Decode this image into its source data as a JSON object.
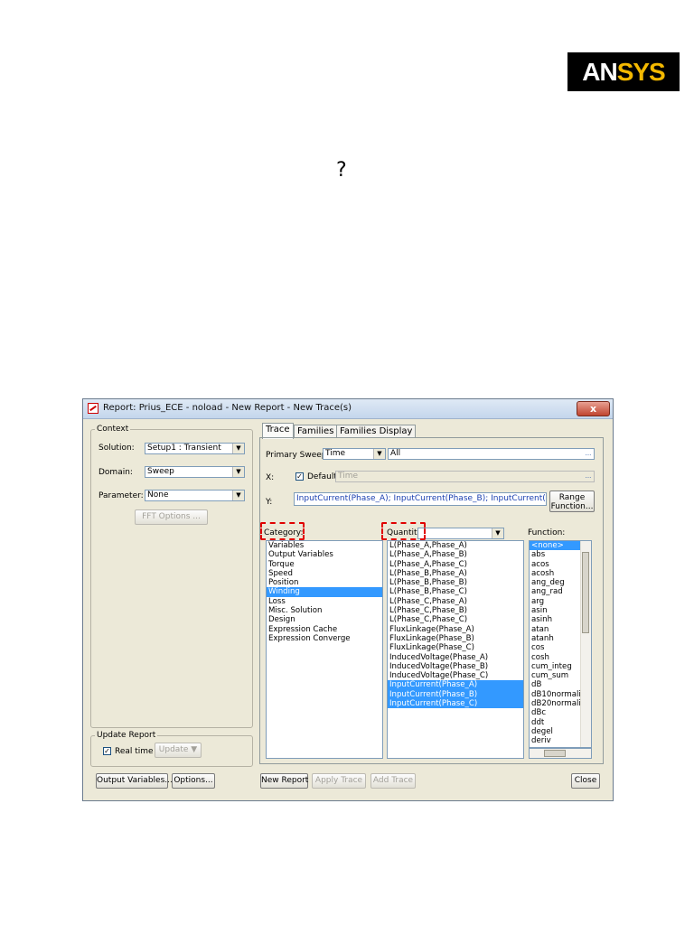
{
  "logo": {
    "part1": "AN",
    "part2": "SYS"
  },
  "question_mark": "?",
  "dialog": {
    "title": "Report: Prius_ECE - noload - New Report - New Trace(s)",
    "close_glyph": "x",
    "context": {
      "legend": "Context",
      "solution_label": "Solution:",
      "solution_value": "Setup1 : Transient",
      "domain_label": "Domain:",
      "domain_value": "Sweep",
      "parameter_label": "Parameter:",
      "parameter_value": "None",
      "fft_button": "FFT Options ..."
    },
    "update": {
      "legend": "Update Report",
      "realtime_label": "Real time",
      "realtime_checked": true,
      "update_button": "Update"
    },
    "tabs": [
      "Trace",
      "Families",
      "Families Display"
    ],
    "trace": {
      "primary_sweep_label": "Primary Sweep:",
      "primary_sweep_value": "Time",
      "primary_sweep_range": "All",
      "x_label": "X:",
      "default_label": "Default",
      "default_checked": true,
      "x_value": "Time",
      "y_label": "Y:",
      "y_value": "InputCurrent(Phase_A); InputCurrent(Phase_B); InputCurrent(Phase_C)",
      "range_function_button": [
        "Range",
        "Function..."
      ],
      "category_label": "Category:",
      "quantity_label": "Quantity:",
      "function_label": "Function:",
      "categories": [
        "Variables",
        "Output Variables",
        "Torque",
        "Speed",
        "Position",
        "Winding",
        "Loss",
        "Misc. Solution",
        "Design",
        "Expression Cache",
        "Expression Converge"
      ],
      "category_selected": 5,
      "quantities": [
        "L(Phase_A,Phase_A)",
        "L(Phase_A,Phase_B)",
        "L(Phase_A,Phase_C)",
        "L(Phase_B,Phase_A)",
        "L(Phase_B,Phase_B)",
        "L(Phase_B,Phase_C)",
        "L(Phase_C,Phase_A)",
        "L(Phase_C,Phase_B)",
        "L(Phase_C,Phase_C)",
        "FluxLinkage(Phase_A)",
        "FluxLinkage(Phase_B)",
        "FluxLinkage(Phase_C)",
        "InducedVoltage(Phase_A)",
        "InducedVoltage(Phase_B)",
        "InducedVoltage(Phase_C)",
        "InputCurrent(Phase_A)",
        "InputCurrent(Phase_B)",
        "InputCurrent(Phase_C)"
      ],
      "quantity_selected": [
        15,
        16,
        17
      ],
      "functions": [
        "<none>",
        "abs",
        "acos",
        "acosh",
        "ang_deg",
        "ang_rad",
        "arg",
        "asin",
        "asinh",
        "atan",
        "atanh",
        "cos",
        "cosh",
        "cum_integ",
        "cum_sum",
        "dB",
        "dB10normalize",
        "dB20normalize",
        "dBc",
        "ddt",
        "degel",
        "deriv"
      ],
      "function_selected": 0
    },
    "bottom": {
      "output_variables": "Output Variables...",
      "options": "Options...",
      "new_report": "New Report",
      "apply_trace": "Apply Trace",
      "add_trace": "Add Trace",
      "close": "Close"
    }
  }
}
